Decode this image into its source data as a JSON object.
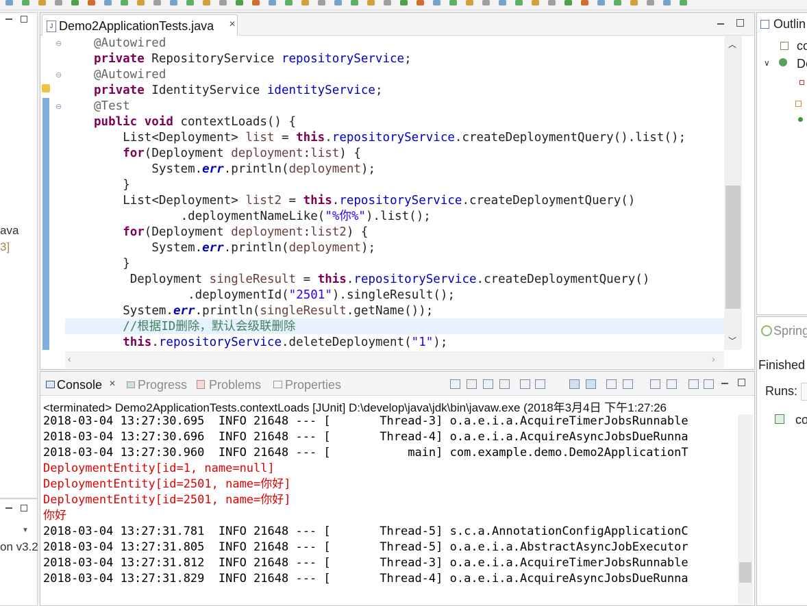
{
  "editor": {
    "tab_title": "Demo2ApplicationTests.java",
    "close_glyph": "✕",
    "file_icon": "java-file-icon"
  },
  "code": [
    {
      "indent": 0,
      "tokens": [
        {
          "c": "an",
          "t": "@Autowired"
        }
      ]
    },
    {
      "indent": 0,
      "tokens": [
        {
          "c": "kw",
          "t": "private"
        },
        {
          "c": "",
          "t": " RepositoryService "
        },
        {
          "c": "fld",
          "t": "repositoryService"
        },
        {
          "c": "",
          "t": ";"
        }
      ]
    },
    {
      "indent": 0,
      "tokens": [
        {
          "c": "an",
          "t": "@Autowired"
        }
      ]
    },
    {
      "indent": 0,
      "tokens": [
        {
          "c": "kw",
          "t": "private"
        },
        {
          "c": "",
          "t": " IdentityService "
        },
        {
          "c": "fld",
          "t": "identityService"
        },
        {
          "c": "",
          "t": ";"
        }
      ]
    },
    {
      "indent": 0,
      "tokens": [
        {
          "c": "an",
          "t": "@Test"
        }
      ]
    },
    {
      "indent": 0,
      "tokens": [
        {
          "c": "kw",
          "t": "public"
        },
        {
          "c": "",
          "t": " "
        },
        {
          "c": "kw",
          "t": "void"
        },
        {
          "c": "",
          "t": " contextLoads() {"
        }
      ]
    },
    {
      "indent": 4,
      "tokens": [
        {
          "c": "",
          "t": "List<Deployment> "
        },
        {
          "c": "lv",
          "t": "list"
        },
        {
          "c": "",
          "t": " = "
        },
        {
          "c": "kw",
          "t": "this"
        },
        {
          "c": "",
          "t": "."
        },
        {
          "c": "fld",
          "t": "repositoryService"
        },
        {
          "c": "",
          "t": ".createDeploymentQuery().list();"
        }
      ]
    },
    {
      "indent": 4,
      "tokens": [
        {
          "c": "kw",
          "t": "for"
        },
        {
          "c": "",
          "t": "(Deployment "
        },
        {
          "c": "lv",
          "t": "deployment"
        },
        {
          "c": "",
          "t": ":"
        },
        {
          "c": "lv",
          "t": "list"
        },
        {
          "c": "",
          "t": ") {"
        }
      ]
    },
    {
      "indent": 8,
      "tokens": [
        {
          "c": "",
          "t": "System."
        },
        {
          "c": "itfld",
          "t": "err"
        },
        {
          "c": "",
          "t": ".println("
        },
        {
          "c": "lv",
          "t": "deployment"
        },
        {
          "c": "",
          "t": ");"
        }
      ]
    },
    {
      "indent": 4,
      "tokens": [
        {
          "c": "",
          "t": "}"
        }
      ]
    },
    {
      "indent": 4,
      "tokens": [
        {
          "c": "",
          "t": "List<Deployment> "
        },
        {
          "c": "lv",
          "t": "list2"
        },
        {
          "c": "",
          "t": " = "
        },
        {
          "c": "kw",
          "t": "this"
        },
        {
          "c": "",
          "t": "."
        },
        {
          "c": "fld",
          "t": "repositoryService"
        },
        {
          "c": "",
          "t": ".createDeploymentQuery()"
        }
      ]
    },
    {
      "indent": 12,
      "tokens": [
        {
          "c": "",
          "t": ".deploymentNameLike("
        },
        {
          "c": "st",
          "t": "\"%你%\""
        },
        {
          "c": "",
          "t": ").list();"
        }
      ]
    },
    {
      "indent": 4,
      "tokens": [
        {
          "c": "kw",
          "t": "for"
        },
        {
          "c": "",
          "t": "(Deployment "
        },
        {
          "c": "lv",
          "t": "deployment"
        },
        {
          "c": "",
          "t": ":"
        },
        {
          "c": "lv",
          "t": "list2"
        },
        {
          "c": "",
          "t": ") {"
        }
      ]
    },
    {
      "indent": 8,
      "tokens": [
        {
          "c": "",
          "t": "System."
        },
        {
          "c": "itfld",
          "t": "err"
        },
        {
          "c": "",
          "t": ".println("
        },
        {
          "c": "lv",
          "t": "deployment"
        },
        {
          "c": "",
          "t": ");"
        }
      ]
    },
    {
      "indent": 4,
      "tokens": [
        {
          "c": "",
          "t": "}"
        }
      ]
    },
    {
      "indent": 5,
      "tokens": [
        {
          "c": "",
          "t": "Deployment "
        },
        {
          "c": "lv",
          "t": "singleResult"
        },
        {
          "c": "",
          "t": " = "
        },
        {
          "c": "kw",
          "t": "this"
        },
        {
          "c": "",
          "t": "."
        },
        {
          "c": "fld",
          "t": "repositoryService"
        },
        {
          "c": "",
          "t": ".createDeploymentQuery()"
        }
      ]
    },
    {
      "indent": 13,
      "tokens": [
        {
          "c": "",
          "t": ".deploymentId("
        },
        {
          "c": "st",
          "t": "\"2501\""
        },
        {
          "c": "",
          "t": ").singleResult();"
        }
      ]
    },
    {
      "indent": 4,
      "tokens": [
        {
          "c": "",
          "t": "System."
        },
        {
          "c": "itfld",
          "t": "err"
        },
        {
          "c": "",
          "t": ".println("
        },
        {
          "c": "lv",
          "t": "singleResult"
        },
        {
          "c": "",
          "t": ".getName());"
        }
      ]
    },
    {
      "indent": 4,
      "tokens": [
        {
          "c": "cm",
          "t": "//根据ID删除，默认会级联删除"
        }
      ]
    },
    {
      "indent": 4,
      "tokens": [
        {
          "c": "kw",
          "t": "this"
        },
        {
          "c": "",
          "t": "."
        },
        {
          "c": "fld",
          "t": "repositoryService"
        },
        {
          "c": "",
          "t": ".deleteDeployment("
        },
        {
          "c": "st",
          "t": "\"1\""
        },
        {
          "c": "",
          "t": ");"
        }
      ]
    }
  ],
  "console": {
    "tabs": [
      {
        "label": "Console",
        "icon": "console-icon",
        "active": true
      },
      {
        "label": "Progress",
        "icon": "progress-icon",
        "active": false
      },
      {
        "label": "Problems",
        "icon": "problems-icon",
        "active": false
      },
      {
        "label": "Properties",
        "icon": "properties-icon",
        "active": false
      }
    ],
    "header": "<terminated> Demo2ApplicationTests.contextLoads [JUnit] D:\\develop\\java\\jdk\\bin\\javaw.exe (2018年3月4日 下午1:27:26",
    "lines": [
      {
        "color": "black",
        "text": "2018-03-04 13:27:30.695  INFO 21648 --- [       Thread-3] o.a.e.i.a.AcquireTimerJobsRunnable"
      },
      {
        "color": "black",
        "text": "2018-03-04 13:27:30.696  INFO 21648 --- [       Thread-4] o.a.e.i.a.AcquireAsyncJobsDueRunna"
      },
      {
        "color": "black",
        "text": "2018-03-04 13:27:30.960  INFO 21648 --- [           main] com.example.demo.Demo2ApplicationT"
      },
      {
        "color": "red",
        "text": "DeploymentEntity[id=1, name=null]"
      },
      {
        "color": "red",
        "text": "DeploymentEntity[id=2501, name=你好]"
      },
      {
        "color": "red",
        "text": "DeploymentEntity[id=2501, name=你好]"
      },
      {
        "color": "red",
        "text": "你好"
      },
      {
        "color": "black",
        "text": "2018-03-04 13:27:31.781  INFO 21648 --- [       Thread-5] s.c.a.AnnotationConfigApplicationC"
      },
      {
        "color": "black",
        "text": "2018-03-04 13:27:31.805  INFO 21648 --- [       Thread-5] o.a.e.i.a.AbstractAsyncJobExecutor"
      },
      {
        "color": "black",
        "text": "2018-03-04 13:27:31.812  INFO 21648 --- [       Thread-3] o.a.e.i.a.AcquireTimerJobsRunnable"
      },
      {
        "color": "black",
        "text": "2018-03-04 13:27:31.829  INFO 21648 --- [       Thread-4] o.a.e.i.a.AcquireAsyncJobsDueRunna"
      }
    ]
  },
  "outline": {
    "title": "Outlin",
    "items": [
      "co",
      "De"
    ]
  },
  "spring": {
    "title": "Spring",
    "finished": "Finished",
    "runs": "Runs:",
    "item": "cor"
  },
  "left": {
    "text1": "ava",
    "text2": "3]",
    "text3": "on v3.2"
  },
  "colors": {
    "keyword": "#7f0055",
    "field": "#0000c0",
    "string": "#2a00ff",
    "comment": "#3f7f5f",
    "stderr": "#e00000"
  }
}
